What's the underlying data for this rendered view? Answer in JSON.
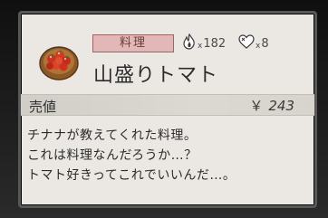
{
  "item": {
    "category": "料理",
    "name": "山盛りトマト",
    "icon": "tomato-bowl-icon",
    "stats": {
      "fire": {
        "icon": "flame-icon",
        "multiplier": "x",
        "value": "182"
      },
      "heart": {
        "icon": "heart-icon",
        "multiplier": "x",
        "value": "8"
      }
    }
  },
  "price": {
    "label": "売値",
    "currency": "￥",
    "value": "243"
  },
  "description": [
    "チナナが教えてくれた料理。",
    "これは料理なんだろうか…？",
    "トマト好きってこれでいいんだ…。"
  ],
  "colors": {
    "card_bg": "#ebe8e3",
    "tag_bg": "#e2b7b7",
    "tomato_red": "#c8321e"
  }
}
